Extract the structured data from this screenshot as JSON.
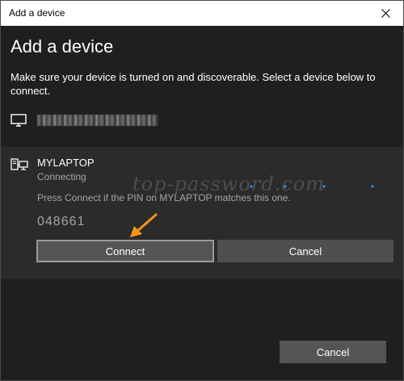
{
  "window": {
    "title": "Add a device",
    "close_icon": "close-icon"
  },
  "header": {
    "heading": "Add a device",
    "subtitle": "Make sure your device is turned on and discoverable. Select a device below to connect."
  },
  "devices": [
    {
      "icon": "monitor-icon",
      "name_blurred": true
    },
    {
      "icon": "computer-network-icon",
      "name": "MYLAPTOP",
      "status": "Connecting",
      "message": "Press Connect if the PIN on MYLAPTOP matches this one.",
      "pin": "048661",
      "connect_label": "Connect",
      "cancel_label": "Cancel"
    }
  ],
  "footer": {
    "cancel_label": "Cancel"
  },
  "watermark": "top-password.com",
  "colors": {
    "background": "#1f1f1f",
    "selected_row": "#2b2b2b",
    "button": "#4f4f4f",
    "arrow": "#f7941d",
    "progress_dot": "#2d8cff"
  }
}
